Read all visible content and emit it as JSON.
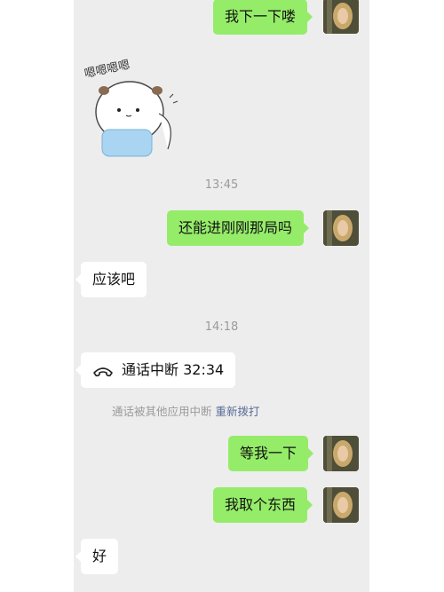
{
  "messages": {
    "m1": {
      "text": "我下一下喽",
      "direction": "outgoing"
    },
    "m2": {
      "text": "还能进刚刚那局吗",
      "direction": "outgoing"
    },
    "m3": {
      "text": "应该吧",
      "direction": "incoming"
    },
    "m4": {
      "text": "等我一下",
      "direction": "outgoing"
    },
    "m5": {
      "text": "我取个东西",
      "direction": "outgoing"
    },
    "m6": {
      "text": "好",
      "direction": "incoming"
    }
  },
  "timestamps": {
    "t1": "13:45",
    "t2": "14:18"
  },
  "sticker": {
    "caption": "嗯嗯嗯嗯",
    "icon": "cat-sticker"
  },
  "call": {
    "label": "通话中断 32:34",
    "icon": "phone-hangup-icon"
  },
  "system_note": {
    "text": "通话被其他应用中断",
    "link": "重新拨打"
  },
  "colors": {
    "chat_bg": "#ededed",
    "outgoing_bubble": "#95ec69",
    "incoming_bubble": "#ffffff",
    "link": "#576b95",
    "muted": "#9b9b9b"
  }
}
